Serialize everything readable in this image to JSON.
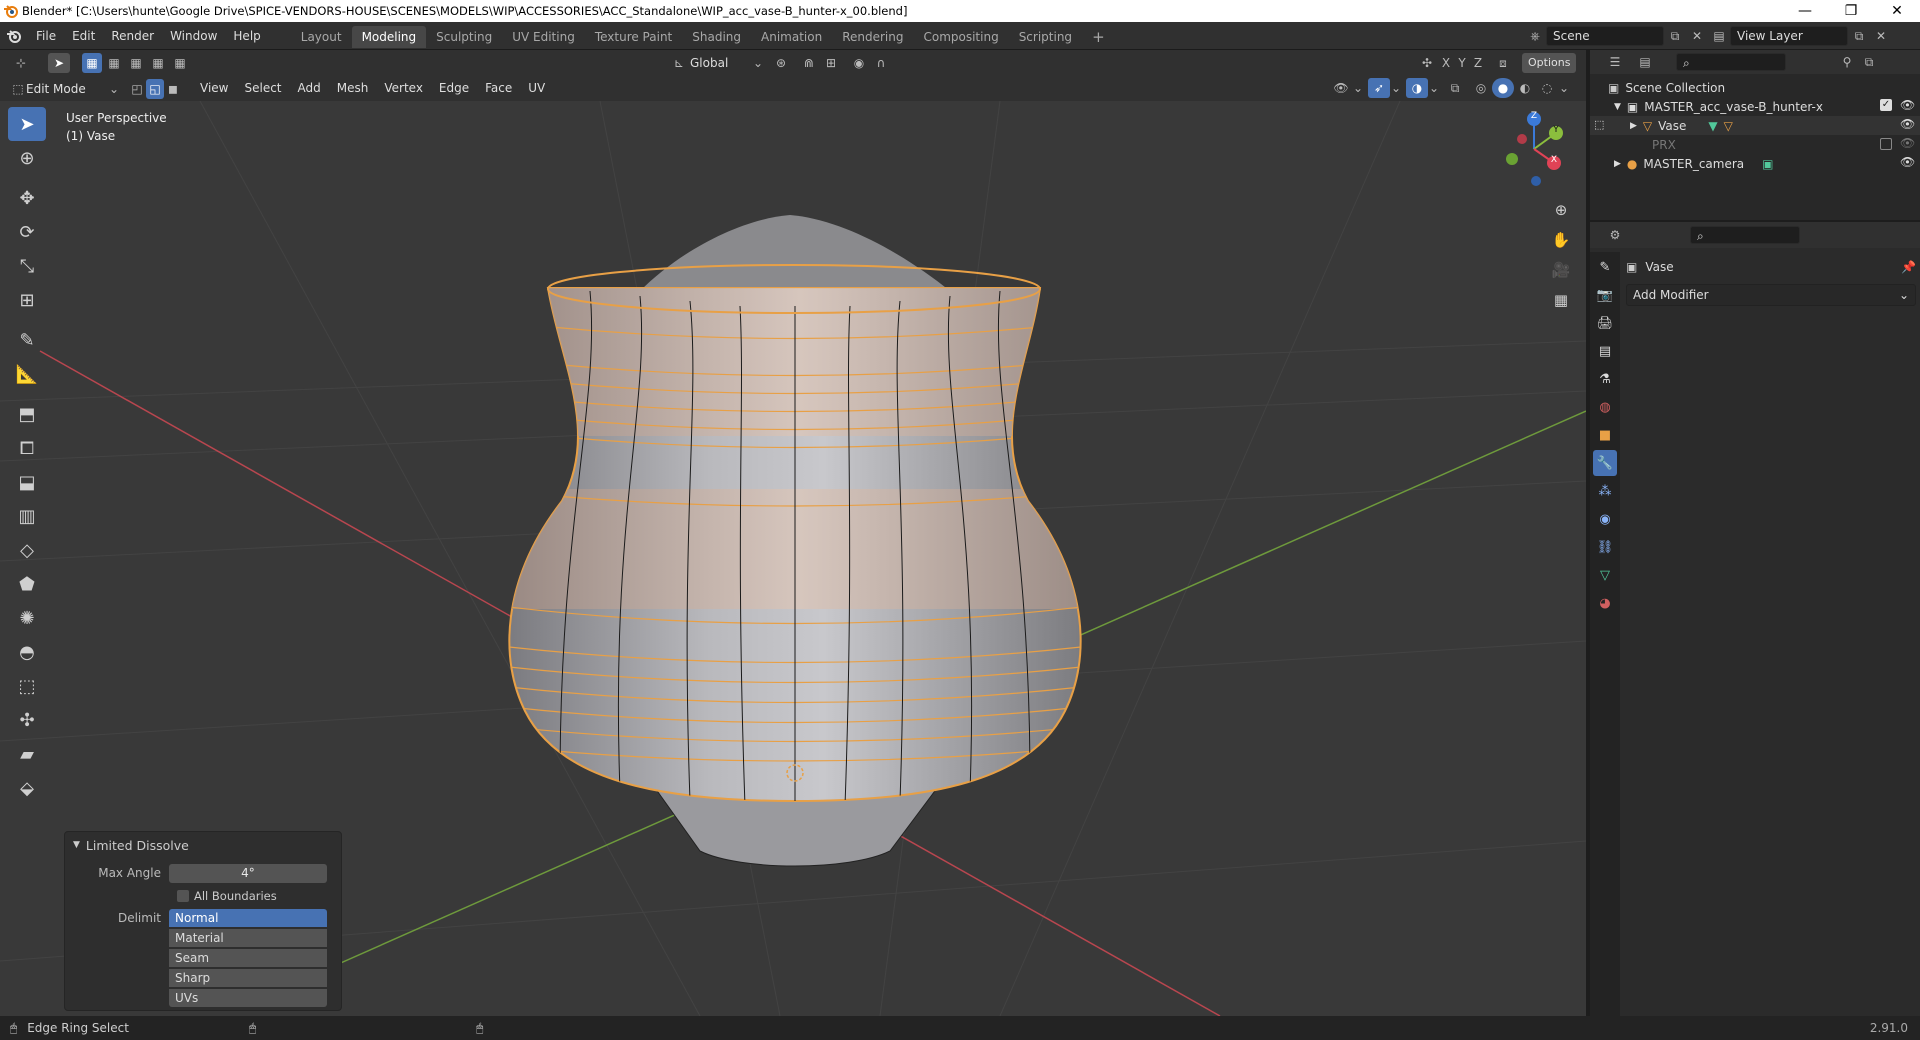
{
  "window": {
    "title": "Blender* [C:\\Users\\hunte\\Google Drive\\SPICE-VENDORS-HOUSE\\SCENES\\MODELS\\WIP\\ACCESSORIES\\ACC_Standalone\\WIP_acc_vase-B_hunter-x_00.blend]",
    "minimize": "—",
    "restore": "❐",
    "close": "✕"
  },
  "menu": [
    "File",
    "Edit",
    "Render",
    "Window",
    "Help"
  ],
  "workspaces": [
    "Layout",
    "Modeling",
    "Sculpting",
    "UV Editing",
    "Texture Paint",
    "Shading",
    "Animation",
    "Rendering",
    "Compositing",
    "Scripting"
  ],
  "active_workspace": "Modeling",
  "add_workspace": "+",
  "scene": {
    "name": "Scene",
    "view_layer": "View Layer"
  },
  "viewport_header": {
    "transform_orientation": "Global",
    "axes": [
      "X",
      "Y",
      "Z"
    ],
    "options": "Options"
  },
  "mode_header": {
    "mode": "Edit Mode",
    "menus": [
      "View",
      "Select",
      "Add",
      "Mesh",
      "Vertex",
      "Edge",
      "Face",
      "UV"
    ]
  },
  "overlay_text": {
    "perspective": "User Perspective",
    "object": "(1) Vase"
  },
  "gizmo": {
    "z": "Z",
    "y": "Y",
    "x": "X"
  },
  "operator": {
    "title": "Limited Dissolve",
    "max_angle_label": "Max Angle",
    "max_angle_value": "4°",
    "all_boundaries": "All Boundaries",
    "delimit_label": "Delimit",
    "delimit_options": [
      "Normal",
      "Material",
      "Seam",
      "Sharp",
      "UVs"
    ],
    "delimit_selected": "Normal"
  },
  "outliner": {
    "root": "Scene Collection",
    "items": [
      {
        "name": "MASTER_acc_vase-B_hunter-x"
      },
      {
        "name": "Vase"
      },
      {
        "name": "PRX"
      },
      {
        "name": "MASTER_camera"
      }
    ]
  },
  "properties": {
    "object_name": "Vase",
    "add_modifier": "Add Modifier"
  },
  "status": {
    "left": "Edge Ring Select",
    "version": "2.91.0"
  },
  "colors": {
    "accent": "#4772b3",
    "selection": "#e8a046",
    "x_axis": "#b8464f",
    "y_axis": "#6e9a3c"
  }
}
